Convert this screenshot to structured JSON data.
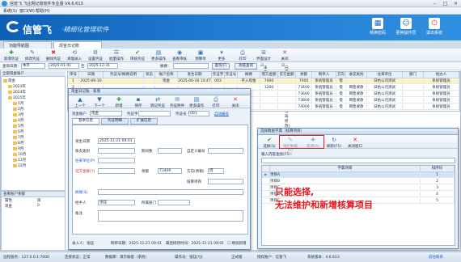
{
  "window": {
    "title": "信管飞 飞企网记账软件专业版 V4.6.613"
  },
  "menu": [
    "系统(S)",
    "窗口(W)",
    "帮助(H)"
  ],
  "banner": {
    "brand": "信管飞",
    "slogan": "·精细化管理软件",
    "icons": [
      "频换密码",
      "更换操作员",
      "退出系统"
    ]
  },
  "tabs": [
    "功能导航图",
    "现金日记账"
  ],
  "toolbar": [
    "新增凭证",
    "修改凭证",
    "删除凭证",
    "清理录入",
    "设置凭证",
    "批量操作",
    "审核凭证",
    "更多操作",
    "查看审核",
    "预算单",
    "更多",
    "打印",
    "界面设计",
    "关闭"
  ],
  "query": {
    "label_date": "查询日期：",
    "date_mode": "本年",
    "date_from": "2025-01-01",
    "to": "至",
    "date_to": "2025-12-31",
    "summary_label": "摘要：",
    "search_btn": "查询(F)",
    "advanced_btn": "高级查询",
    "check_unaudited": "未审核",
    "check_audited": "已审核(已审核状态无法再修改)"
  },
  "tree": {
    "header": "全部现金账户",
    "nodes": [
      "现金",
      "2023年",
      "2024年",
      "2025年",
      "1月",
      "2月",
      "3月",
      "4月",
      "5月",
      "6月",
      "7月",
      "8月",
      "9月",
      "10月",
      "11月",
      "12月"
    ]
  },
  "balance": {
    "header": "查看账户余额",
    "cols": [
      "属性",
      "值"
    ],
    "row": [
      "现金",
      "0"
    ]
  },
  "grid": {
    "cols": [
      "序号",
      "日期",
      "凭证号/摘要说明",
      "状态",
      "账户名称",
      "发生日期",
      "凭证字",
      "凭证号",
      "摘要",
      "借方金额",
      "贷方金额",
      "余额",
      "制单人",
      "方向",
      "收支类别",
      "往来单位",
      "部门",
      "经办人"
    ],
    "rows": [
      [
        "1",
        "2025-06-16",
        "",
        "",
        "现金",
        "2025-06-16 14:47",
        "003",
        "",
        "存入现金",
        "7000",
        "",
        "7000",
        "系统管理员",
        "借",
        "",
        "日杭公司测试",
        "",
        "系统管理员"
      ],
      [
        "2",
        "",
        "",
        "",
        "",
        "",
        "",
        "",
        "",
        "1200",
        "",
        "73400",
        "系统管理员",
        "借",
        "销售收款",
        "日杭公司测试",
        "",
        "系统管理员"
      ],
      [
        "3",
        "",
        "",
        "",
        "",
        "",
        "",
        "",
        "",
        "",
        "",
        "",
        "系统管理员",
        "借",
        "销售收款",
        "日杭公司测试",
        "",
        "系统管理员"
      ],
      [
        "4",
        "",
        "",
        "",
        "",
        "",
        "",
        "",
        "",
        "",
        "",
        "",
        "系统管理员",
        "借",
        "销售收款",
        "日杭公司测试",
        "",
        "系统管理员"
      ],
      [
        "5",
        "",
        "",
        "",
        "",
        "",
        "",
        "",
        "",
        "",
        "",
        "",
        "系统管理员",
        "借",
        "销售收款",
        "日杭公司测试",
        "",
        "系统管理员"
      ]
    ],
    "extra_vals": [
      "73600",
      "73800",
      "74000"
    ]
  },
  "dialog1": {
    "title": "现金日记账 - 新增",
    "buttons": [
      "上一个",
      "下一个",
      "新增",
      "保存",
      "转记凭证",
      "凭证附件",
      "更多操作",
      "打印",
      "关闭"
    ],
    "account_label": "资金账户",
    "account_value": "现金",
    "voucher_type_label": "凭证字",
    "voucher_no_label": "凭证号",
    "voucher_no_value": "001",
    "auto_label": "自动编号",
    "tabs": [
      "基本信息",
      "凭证明细",
      "扩展信息"
    ],
    "date_label": "发生日期",
    "date_value": "2025-11-21 09:01",
    "category_label": "收支类别",
    "period_label": "期间数",
    "custom_label": "自定义编号",
    "unit_label": "往来单位(P)",
    "amount_label": "贷方金额(Y)",
    "balance_label": "余额",
    "balance_value": "73400",
    "direction_label": "方向(余额)",
    "direction_value": "借",
    "project_label": "核算项目",
    "summary_label": "摘要(S)",
    "handler_label": "经手人",
    "handler_value": "张廷",
    "dept_label": "所属部门",
    "note_label": "备注",
    "footer": [
      "录入人：张廷",
      "制单日期：2025-11-21 09:01",
      "最后修改时间：2025-11-21 09:01"
    ],
    "footer_check": "继续新增"
  },
  "dialog2": {
    "title": "选择数据字典（核算项目）",
    "buttons": [
      "选择(S)",
      "维护数据(F)",
      "新增(A)",
      "刷新(F5)",
      "关闭窗口"
    ],
    "input_label": "输入内容查找(F5)：",
    "cols": [
      "",
      "字典项目",
      "排序码"
    ],
    "rows": [
      [
        "▸",
        "项目A",
        "1"
      ],
      [
        "",
        "项目B",
        "2"
      ],
      [
        "",
        "项目C",
        "3"
      ],
      [
        "",
        "项目D",
        "4"
      ],
      [
        "",
        "项目E",
        "5"
      ]
    ]
  },
  "annotation": [
    "只能选择,",
    "无法维护和新增核算项目"
  ],
  "status": [
    "远程服务：127.0.0.1:7000",
    "连接状态：正常",
    "数据库：演示账套（系统）",
    "操作员：张廷(YJ)",
    "正式版",
    "授权账户：信管飞",
    "系统版本：4.6.613",
    "前往联系"
  ],
  "colors": {
    "banner": "#1f7ad0",
    "annotation": "#e8161d"
  }
}
